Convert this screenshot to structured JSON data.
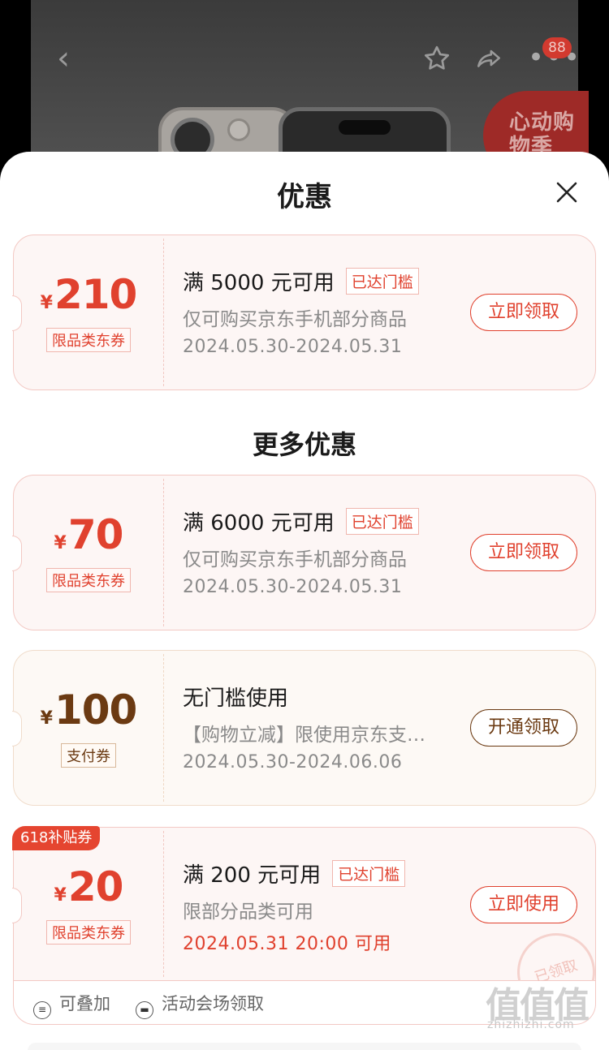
{
  "background": {
    "cart_count": "88",
    "promo_text": "心动购物季"
  },
  "sheet": {
    "title": "优惠",
    "more_title": "更多优惠"
  },
  "coupons": [
    {
      "currency": "¥",
      "amount": "210",
      "type_tag": "限品类东券",
      "condition": "满 5000 元可用",
      "status_badge": "已达门槛",
      "scope": "仅可购买京东手机部分商品",
      "validity": "2024.05.30-2024.05.31",
      "action": "立即领取"
    },
    {
      "currency": "¥",
      "amount": "70",
      "type_tag": "限品类东券",
      "condition": "满 6000 元可用",
      "status_badge": "已达门槛",
      "scope": "仅可购买京东手机部分商品",
      "validity": "2024.05.30-2024.05.31",
      "action": "立即领取"
    },
    {
      "currency": "¥",
      "amount": "100",
      "type_tag": "支付券",
      "condition": "无门槛使用",
      "scope": "【购物立减】限使用京东支…",
      "validity": "2024.05.30-2024.06.06",
      "action": "开通领取"
    },
    {
      "corner_tag": "618补贴券",
      "currency": "¥",
      "amount": "20",
      "type_tag": "限品类东券",
      "condition": "满 200 元可用",
      "status_badge": "已达门槛",
      "scope": "限部分品类可用",
      "validity": "2024.05.31 20:00 可用",
      "action": "立即使用",
      "stamp": "已领取"
    }
  ],
  "features": {
    "stackable": "可叠加",
    "venue": "活动会场领取"
  },
  "watermark": {
    "logo": "值值值",
    "url": "zhizhizhi.com"
  },
  "colors": {
    "accent_red": "#e0412e",
    "gold_brown": "#6b3a12"
  }
}
